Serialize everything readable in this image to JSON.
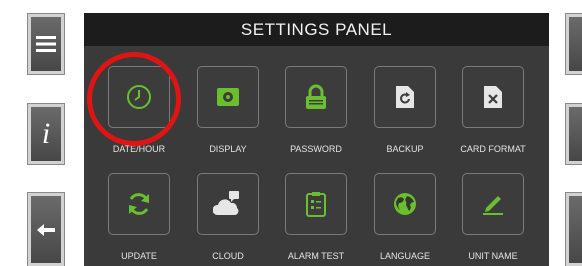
{
  "panel": {
    "title": "SETTINGS PANEL"
  },
  "left_buttons": [
    {
      "name": "menu",
      "icon": "menu-icon"
    },
    {
      "name": "info",
      "icon": "info-icon",
      "glyph": "i"
    },
    {
      "name": "back",
      "icon": "back-arrow-icon"
    }
  ],
  "tiles": [
    {
      "label": "DATE/HOUR",
      "icon": "clock-icon"
    },
    {
      "label": "DISPLAY",
      "icon": "display-gear-icon"
    },
    {
      "label": "PASSWORD",
      "icon": "lock-icon"
    },
    {
      "label": "BACKUP",
      "icon": "backup-icon"
    },
    {
      "label": "CARD FORMAT",
      "icon": "card-format-icon"
    },
    {
      "label": "UPDATE",
      "icon": "refresh-icon"
    },
    {
      "label": "CLOUD",
      "icon": "cloud-icon"
    },
    {
      "label": "ALARM TEST",
      "icon": "clipboard-icon"
    },
    {
      "label": "LANGUAGE",
      "icon": "globe-icon"
    },
    {
      "label": "UNIT NAME",
      "icon": "pencil-icon"
    }
  ],
  "colors": {
    "accent": "#6abf2e",
    "highlight": "#e11414"
  }
}
